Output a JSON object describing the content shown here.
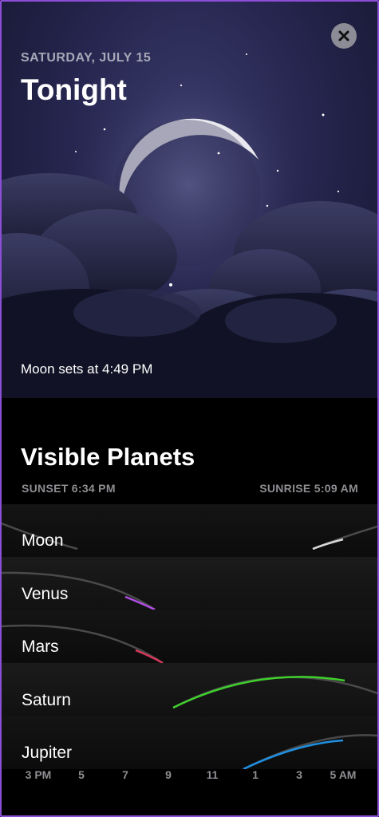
{
  "hero": {
    "date": "SATURDAY, JULY 15",
    "title": "Tonight",
    "moon_set": "Moon sets at 4:49 PM",
    "close_icon": "close-icon"
  },
  "planets": {
    "title": "Visible Planets",
    "sunset": "SUNSET 6:34 PM",
    "sunrise": "SUNRISE 5:09 AM",
    "rows": [
      {
        "name": "Moon",
        "color": "#d9d9d9"
      },
      {
        "name": "Venus",
        "color": "#b14ee6"
      },
      {
        "name": "Mars",
        "color": "#d6365a"
      },
      {
        "name": "Saturn",
        "color": "#3fd02c"
      },
      {
        "name": "Jupiter",
        "color": "#1f8fe0"
      }
    ],
    "time_axis": [
      "3 PM",
      "5",
      "7",
      "9",
      "11",
      "1",
      "3",
      "5 AM"
    ]
  }
}
